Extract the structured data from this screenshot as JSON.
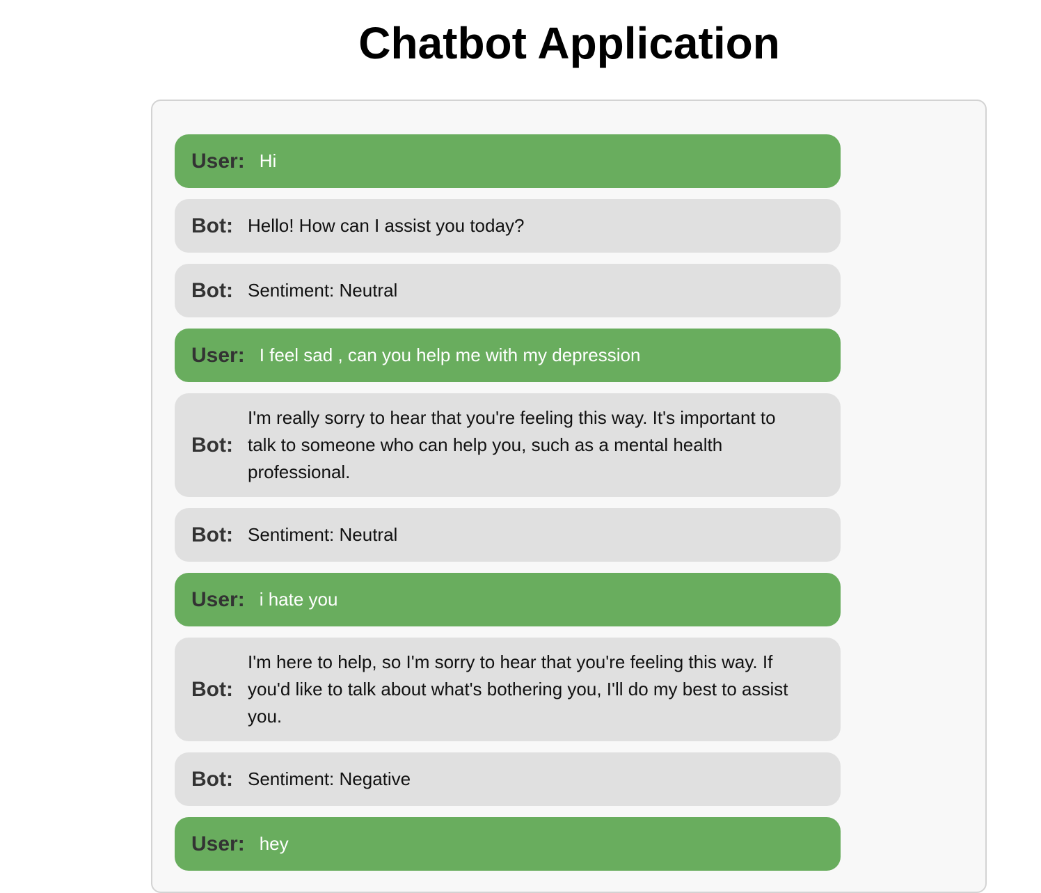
{
  "page": {
    "title": "Chatbot Application"
  },
  "colors": {
    "user_bubble": "#69ad5e",
    "bot_bubble": "#e0e0e0",
    "container_bg": "#f8f8f8"
  },
  "messages": [
    {
      "sender": "User:",
      "role": "user",
      "text": "Hi"
    },
    {
      "sender": "Bot:",
      "role": "bot",
      "text": "Hello! How can I assist you today?"
    },
    {
      "sender": "Bot:",
      "role": "bot",
      "text": "Sentiment: Neutral"
    },
    {
      "sender": "User:",
      "role": "user",
      "text": "I feel sad , can you help me with my depression"
    },
    {
      "sender": "Bot:",
      "role": "bot",
      "text": "I'm really sorry to hear that you're feeling this way. It's important to talk to someone who can help you, such as a mental health professional."
    },
    {
      "sender": "Bot:",
      "role": "bot",
      "text": "Sentiment: Neutral"
    },
    {
      "sender": "User:",
      "role": "user",
      "text": "i hate you"
    },
    {
      "sender": "Bot:",
      "role": "bot",
      "text": "I'm here to help, so I'm sorry to hear that you're feeling this way. If you'd like to talk about what's bothering you, I'll do my best to assist you."
    },
    {
      "sender": "Bot:",
      "role": "bot",
      "text": "Sentiment: Negative"
    },
    {
      "sender": "User:",
      "role": "user",
      "text": "hey"
    }
  ]
}
